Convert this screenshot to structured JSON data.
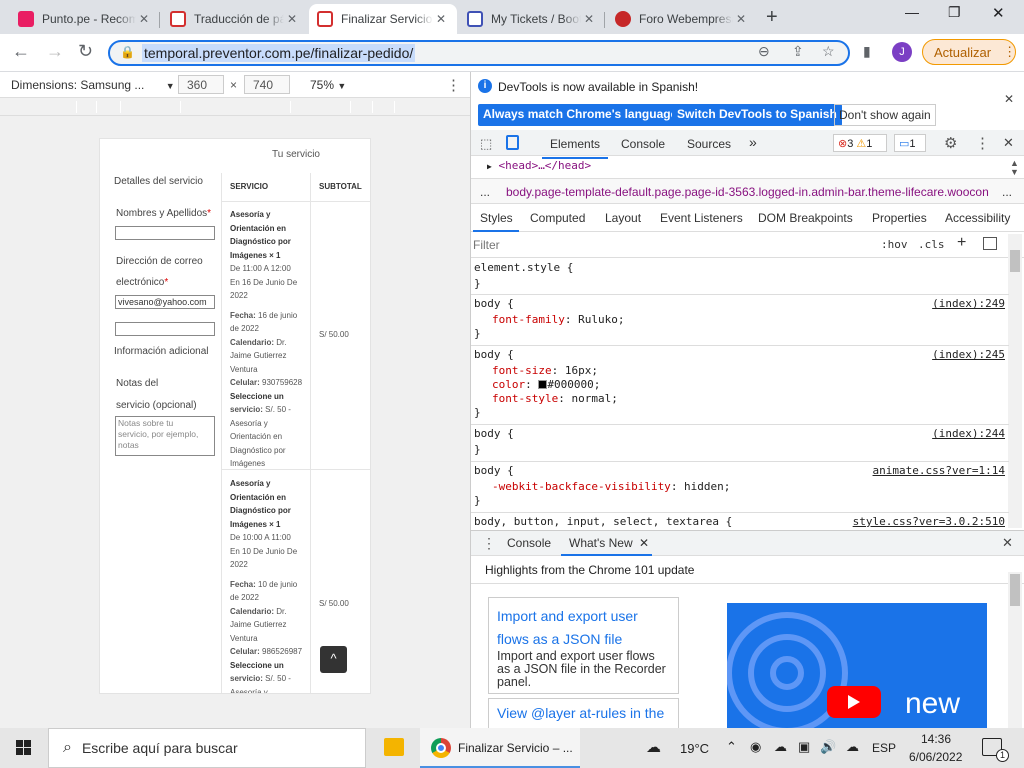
{
  "browser": {
    "tabs": [
      {
        "title": "Punto.pe - Recomendaciones",
        "favicon_color": "#e91e63"
      },
      {
        "title": "Traducción de páginas",
        "favicon_color": "#d32f2f"
      },
      {
        "title": "Finalizar Servicio",
        "favicon_color": "#d32f2f"
      },
      {
        "title": "My Tickets / Bootstrap",
        "favicon_color": "#3f51b5"
      },
      {
        "title": "Foro Webempresa",
        "favicon_color": "#c62828"
      }
    ],
    "new_tab": "+",
    "window_controls": {
      "minimize": "—",
      "restore": "❐",
      "close": "✕"
    },
    "url": "temporal.preventor.com.pe/finalizar-pedido/",
    "avatar_letter": "J",
    "update_label": "Actualizar",
    "update_menu": "⋮"
  },
  "device_toolbar": {
    "device": "Dimensions: Samsung ...",
    "width": "360",
    "times": "×",
    "height": "740",
    "zoom": "75%"
  },
  "page": {
    "section_title": "Tu servicio",
    "details_label": "Detalles del servicio",
    "name_label": "Nombres y Apellidos",
    "required": "*",
    "email_label_1": "Dirección de correo",
    "email_label_2": "electrónico",
    "email_value": "vivesano@yahoo.com",
    "additional_label": "Información adicional",
    "notes_label_1": "Notas del",
    "notes_label_2": "servicio (opcional)",
    "notes_placeholder": "Notas sobre tu servicio, por ejemplo, notas",
    "col_service": "SERVICIO",
    "col_subtotal": "SUBTOTAL",
    "rows": [
      {
        "name_1": "Asesoría y",
        "name_2": "Orientación en",
        "name_3": "Diagnóstico por",
        "name_4": "Imágenes × 1",
        "time_1": "De 11:00 A 12:00",
        "time_2": "En 16 De Junio De",
        "time_3": "2022",
        "fecha_label": "Fecha:",
        "fecha_1": "16 de junio",
        "fecha_2": "de 2022",
        "cal_label": "Calendario:",
        "cal_1": "Dr.",
        "cal_2": "Jaime Gutierrez",
        "cal_3": "Ventura",
        "cel_label": "Celular:",
        "cel": "930759628",
        "sel_label_1": "Seleccione un",
        "sel_label_2": "servicio:",
        "sel_1": "S/. 50 -",
        "sel_2": "Asesoría y",
        "sel_3": "Orientación en",
        "sel_4": "Diagnóstico por",
        "sel_5": "Imágenes",
        "subtotal": "S/ 50.00"
      },
      {
        "name_1": "Asesoría y",
        "name_2": "Orientación en",
        "name_3": "Diagnóstico por",
        "name_4": "Imágenes × 1",
        "time_1": "De 10:00 A 11:00",
        "time_2": "En 10 De Junio De",
        "time_3": "2022",
        "fecha_label": "Fecha:",
        "fecha_1": "10 de junio",
        "fecha_2": "de 2022",
        "cal_label": "Calendario:",
        "cal_1": "Dr.",
        "cal_2": "Jaime Gutierrez",
        "cal_3": "Ventura",
        "cel_label": "Celular:",
        "cel": "986526987",
        "sel_label_1": "Seleccione un",
        "sel_label_2": "servicio:",
        "sel_1": "S/. 50 -",
        "sel_2": "Asesoría y",
        "subtotal": "S/ 50.00"
      }
    ],
    "to_top": "^"
  },
  "devtools": {
    "info": "DevTools is now available in Spanish!",
    "btn_match": "Always match Chrome's language",
    "btn_switch": "Switch DevTools to Spanish",
    "btn_dont": "Don't show again",
    "tabs": [
      "Elements",
      "Console",
      "Sources",
      "»"
    ],
    "errors": "3",
    "warnings": "1",
    "messages": "1",
    "head_node": "<head>…</head>",
    "breadcrumb_dots": "...",
    "breadcrumb": "body.page-template-default.page.page-id-3563.logged-in.admin-bar.theme-lifecare.woocon",
    "style_tabs": [
      "Styles",
      "Computed",
      "Layout",
      "Event Listeners",
      "DOM Breakpoints",
      "Properties",
      "Accessibility"
    ],
    "filter_placeholder": "Filter",
    "hov": ":hov",
    "cls": ".cls",
    "plus": "+",
    "rules": {
      "element_style": "element.style {",
      "close": "}",
      "r1_sel": "body {",
      "r1_prop": "font-family",
      "r1_val": ": Ruluko;",
      "r1_src": "(index):249",
      "r2_sel": "body {",
      "r2_p1": "font-size",
      "r2_v1": ": 16px;",
      "r2_p2": "color",
      "r2_v2": "#000000;",
      "r2_p3": "font-style",
      "r2_v3": ": normal;",
      "r2_src": "(index):245",
      "r3_sel": "body {",
      "r3_src": "(index):244",
      "r4_sel": "body {",
      "r4_prop": "-webkit-backface-visibility",
      "r4_val": ": hidden;",
      "r4_src": "animate.css?ver=1:14",
      "r5_sel": "body, button, input, select, textarea {",
      "r5_src": "style.css?ver=3.0.2:510"
    },
    "drawer_tabs": [
      "Console",
      "What's New"
    ],
    "whatsnew_title": "Highlights from the Chrome 101 update",
    "card_title_1": "Import and export user",
    "card_title_2": "flows as a JSON file",
    "card_desc": "Import and export user flows as a JSON file in the Recorder panel.",
    "card2_title": "View @layer at-rules in the",
    "thumb_text": "new"
  },
  "taskbar": {
    "search_placeholder": "Escribe aquí para buscar",
    "app_title": "Finalizar Servicio – ...",
    "weather": "19°C",
    "lang": "ESP",
    "time": "14:36",
    "date": "6/06/2022",
    "notif_count": "1"
  }
}
